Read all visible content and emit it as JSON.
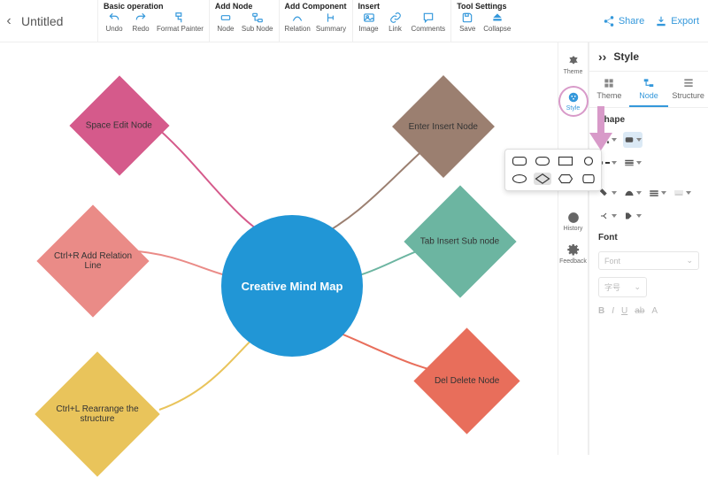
{
  "title": "Untitled",
  "menu": {
    "g1": {
      "hdr": "Basic operation",
      "undo": "Undo",
      "redo": "Redo",
      "fp": "Format Painter"
    },
    "g2": {
      "hdr": "Add Node",
      "node": "Node",
      "sub": "Sub Node"
    },
    "g3": {
      "hdr": "Add Component",
      "rel": "Relation",
      "sum": "Summary"
    },
    "g4": {
      "hdr": "Insert",
      "img": "Image",
      "link": "Link",
      "cmt": "Comments"
    },
    "g5": {
      "hdr": "Tool Settings",
      "save": "Save",
      "col": "Collapse"
    }
  },
  "share": "Share",
  "export": "Export",
  "rstrip": {
    "theme": "Theme",
    "style": "Style",
    "history": "History",
    "feedback": "Feedback"
  },
  "panel": {
    "title": "Style",
    "tabs": {
      "theme": "Theme",
      "node": "Node",
      "structure": "Structure"
    },
    "shape": "Shape",
    "font": "Font",
    "fontSel": "Font",
    "sizeSel": "字号"
  },
  "nodes": {
    "center": "Creative Mind Map",
    "n1": "Space Edit Node",
    "n2": "Ctrl+R Add Relation Line",
    "n3": "Ctrl+L Rearrange the structure",
    "n4": "Enter Insert Node",
    "n5": "Tab Insert Sub node",
    "n6": "Del Delete Node"
  }
}
